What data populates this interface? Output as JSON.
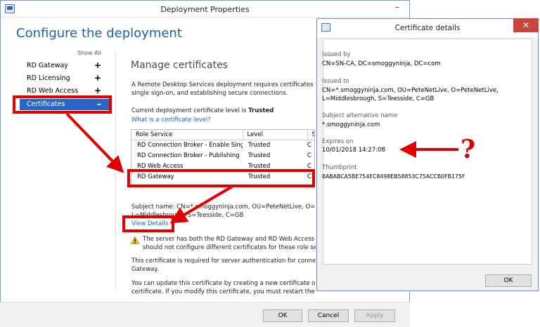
{
  "window": {
    "title": "Deployment Properties",
    "minimize": "–"
  },
  "heading": "Configure the deployment",
  "nav": {
    "show_all": "Show All",
    "items": [
      {
        "label": "RD Gateway",
        "sign": "+"
      },
      {
        "label": "RD Licensing",
        "sign": "+"
      },
      {
        "label": "RD Web Access",
        "sign": "+"
      },
      {
        "label": "Certificates",
        "sign": "–"
      }
    ]
  },
  "section": {
    "title": "Manage certificates",
    "desc1": "A Remote Desktop Services deployment requires certificates for",
    "desc2": "single sign-on, and establishing secure connections.",
    "level_prefix": "Current deployment certificate level is ",
    "level_value": "Trusted",
    "level_link": "What is a certificate level?"
  },
  "table": {
    "columns": [
      "Role Service",
      "Level",
      "Sta"
    ],
    "rows": [
      {
        "role": "RD Connection Broker - Enable Sing",
        "level": "Trusted",
        "status": "C"
      },
      {
        "role": "RD Connection Broker - Publishing",
        "level": "Trusted",
        "status": "C"
      },
      {
        "role": "RD Web Access",
        "level": "Trusted",
        "status": "C"
      },
      {
        "role": "RD Gateway",
        "level": "Trusted",
        "status": "C"
      }
    ]
  },
  "subject": {
    "line1": "Subject name: CN=*.smoggyninja.com, OU=PeteNetLive, O=Pete",
    "line2": "L=Middlesbrough, S=Teesside, C=GB"
  },
  "view_details": "View Details",
  "warning": {
    "line1": "The server has both the RD Gateway and RD Web Access role",
    "line2": "should not configure different certificates for these role serv"
  },
  "info": {
    "line1": "This certificate is required for server authentication for connectio",
    "line2": "Gateway.",
    "line3": "You can update this certificate by creating a new certificate or by",
    "line4": "certificate. If you modify this certificate, you must restart the Rem"
  },
  "buttons": {
    "ok": "OK",
    "cancel": "Cancel",
    "apply": "Apply"
  },
  "dialog": {
    "title": "Certificate details",
    "close": "✕",
    "issued_by_label": "Issued by",
    "issued_by": "CN=SN-CA, DC=smoggyninja, DC=com",
    "issued_to_label": "Issued to",
    "issued_to_1": "CN=*.smoggyninja.com, OU=PeteNetLive, O=PeteNetLive,",
    "issued_to_2": "L=Middlesbrough, S=Teesside, C=GB",
    "san_label": "Subject alternative name",
    "san": "*.smoggyninja.com",
    "expires_label": "Expires on",
    "expires": "10/01/2018 14:27:08",
    "thumb_label": "Thumbprint",
    "thumb": "8ABABCA5BE754EC8498EB58853C75ACCB0FB175F",
    "ok": "OK"
  },
  "annotation": {
    "question": "?",
    "color": "#e00000"
  }
}
